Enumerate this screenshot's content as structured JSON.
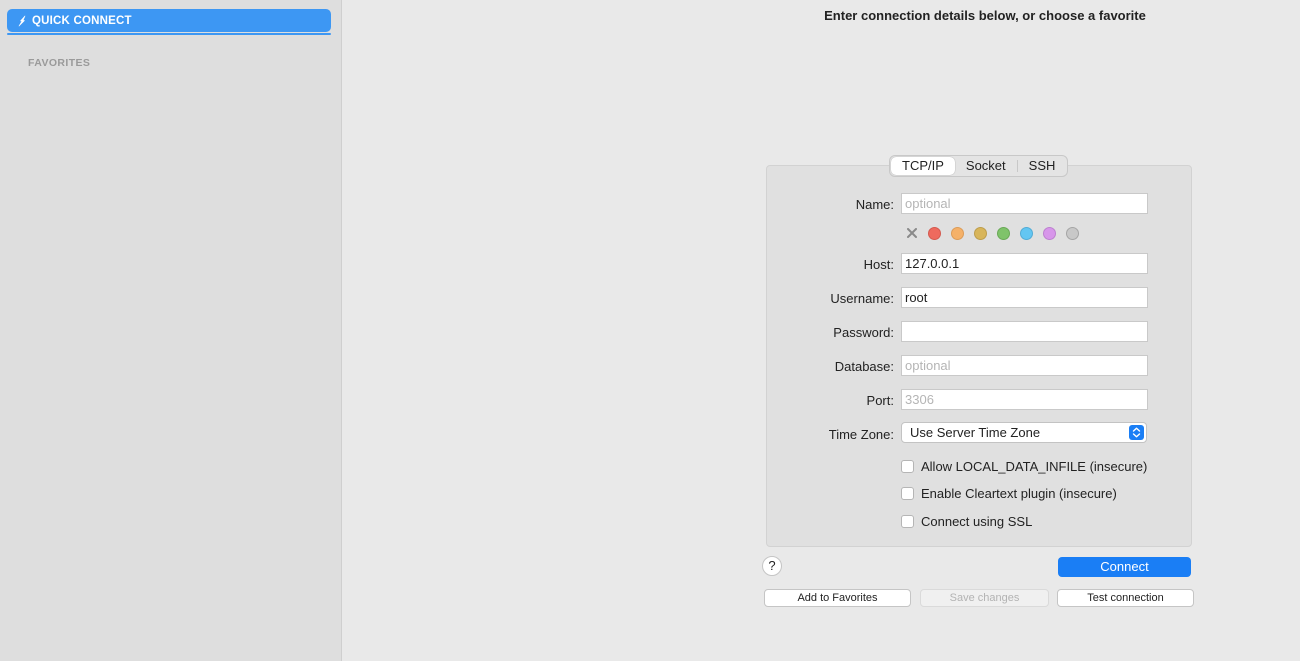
{
  "sidebar": {
    "quick_connect_label": "QUICK CONNECT",
    "favorites_header": "FAVORITES",
    "accent_color": "#3d97f3"
  },
  "main": {
    "headline": "Enter connection details below, or choose a favorite"
  },
  "tabs": [
    {
      "label": "TCP/IP",
      "active": true
    },
    {
      "label": "Socket",
      "active": false
    },
    {
      "label": "SSH",
      "active": false
    }
  ],
  "form": {
    "name": {
      "label": "Name:",
      "value": "",
      "placeholder": "optional"
    },
    "host": {
      "label": "Host:",
      "value": "127.0.0.1",
      "placeholder": ""
    },
    "username": {
      "label": "Username:",
      "value": "root",
      "placeholder": ""
    },
    "password": {
      "label": "Password:",
      "value": "",
      "placeholder": ""
    },
    "database": {
      "label": "Database:",
      "value": "",
      "placeholder": "optional"
    },
    "port": {
      "label": "Port:",
      "value": "",
      "placeholder": "3306"
    },
    "timezone": {
      "label": "Time Zone:",
      "value": "Use Server Time Zone"
    },
    "colors": [
      "#ee6a5e",
      "#f5b169",
      "#d8b55a",
      "#7fc36a",
      "#63c6f2",
      "#d796ea",
      "#c8c8c8"
    ],
    "checkboxes": [
      {
        "label": "Allow LOCAL_DATA_INFILE (insecure)",
        "checked": false
      },
      {
        "label": "Enable Cleartext plugin (insecure)",
        "checked": false
      },
      {
        "label": "Connect using SSL",
        "checked": false
      }
    ]
  },
  "buttons": {
    "help": "?",
    "connect": "Connect",
    "add_favorites": "Add to Favorites",
    "save_changes": "Save changes",
    "test_connection": "Test connection"
  }
}
